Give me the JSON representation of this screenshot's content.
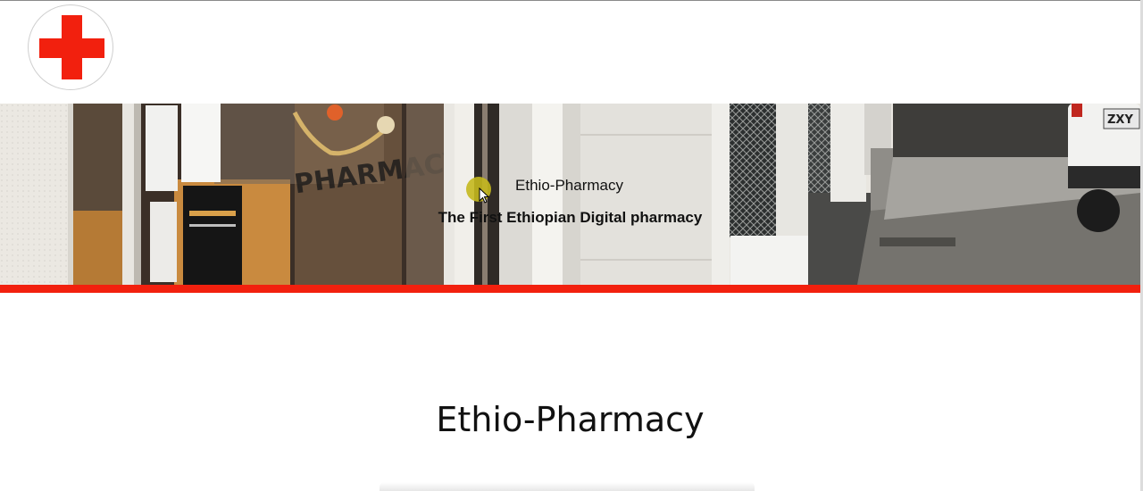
{
  "header": {
    "logo_icon": "red-cross-icon",
    "logo_color": "#f2200e"
  },
  "banner": {
    "title": "Ethio-Pharmacy",
    "subtitle": "The First Ethiopian Digital pharmacy",
    "accent_color": "#f2200e"
  },
  "main": {
    "heading": "Ethio-Pharmacy"
  }
}
